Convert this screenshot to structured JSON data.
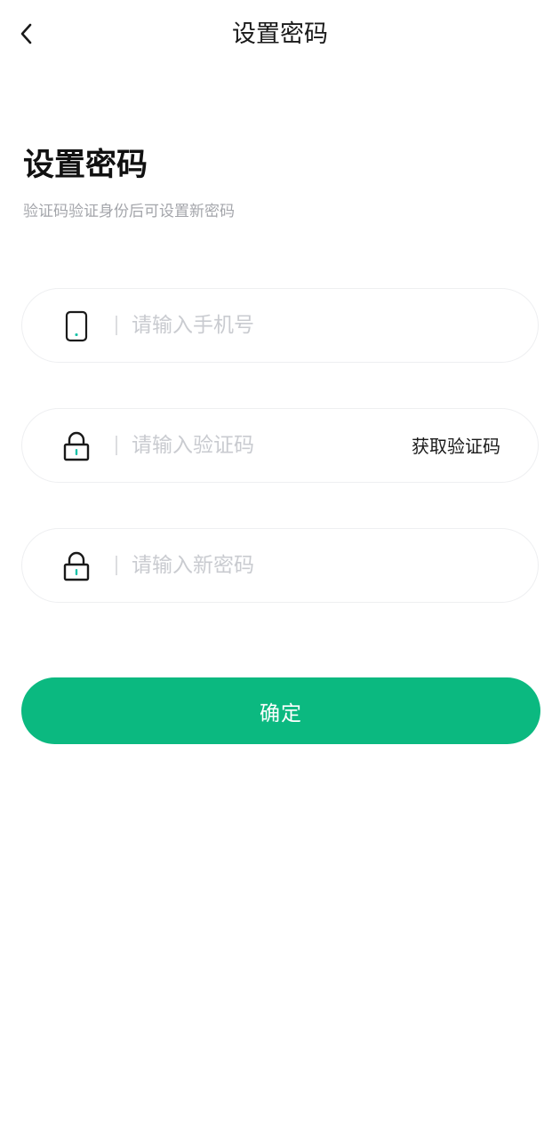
{
  "nav": {
    "title": "设置密码",
    "back_icon": "chevron-left-icon"
  },
  "header": {
    "heading": "设置密码",
    "subheading": "验证码验证身份后可设置新密码"
  },
  "form": {
    "phone": {
      "placeholder": "请输入手机号",
      "value": "",
      "icon": "phone-icon"
    },
    "code": {
      "placeholder": "请输入验证码",
      "value": "",
      "icon": "lock-icon",
      "get_code_label": "获取验证码"
    },
    "password": {
      "placeholder": "请输入新密码",
      "value": "",
      "icon": "lock-icon"
    }
  },
  "confirm": {
    "label": "确定"
  },
  "colors": {
    "accent": "#0bb980",
    "icon_accent": "#19c2a8",
    "placeholder": "#c9cbd0",
    "field_border": "#eeeff1",
    "subtext": "#a4a6ab"
  }
}
